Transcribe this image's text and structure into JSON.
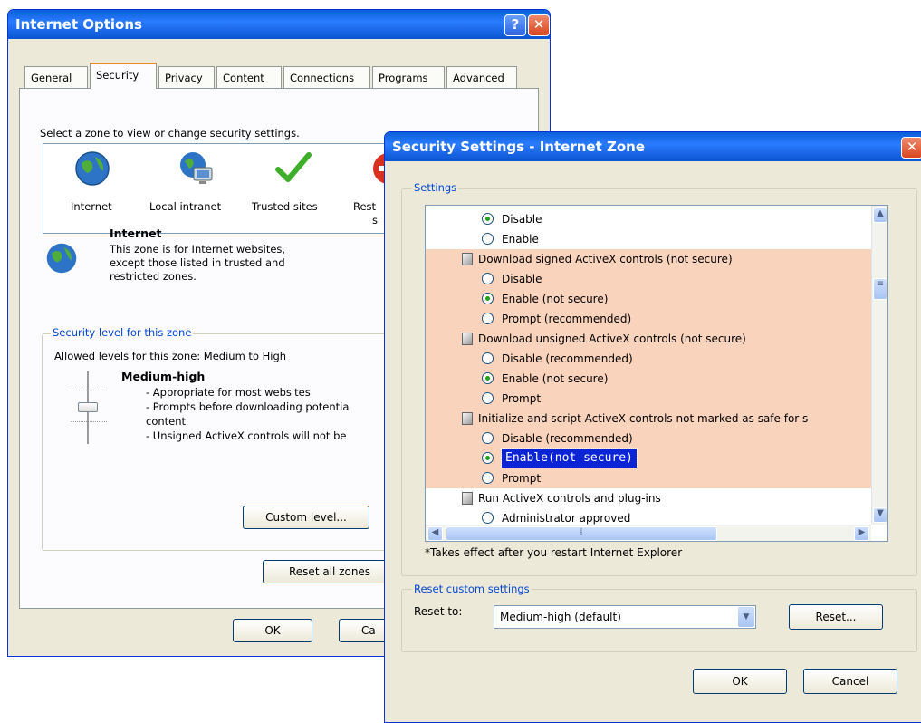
{
  "internet_options": {
    "title": "Internet Options",
    "tabs": [
      "General",
      "Security",
      "Privacy",
      "Content",
      "Connections",
      "Programs",
      "Advanced"
    ],
    "zone_prompt": "Select a zone to view or change security settings.",
    "zones": [
      {
        "label": "Internet",
        "icon": "globe-icon"
      },
      {
        "label": "Local intranet",
        "icon": "intranet-icon"
      },
      {
        "label": "Trusted sites",
        "icon": "checkmark-icon"
      },
      {
        "label": "Rest",
        "label2": "s",
        "icon": "restricted-icon"
      }
    ],
    "zone_title": "Internet",
    "zone_desc_1": "This zone is for Internet websites,",
    "zone_desc_2": "except those listed in trusted and",
    "zone_desc_3": "restricted zones.",
    "security_group": "Security level for this zone",
    "allowed_levels": "Allowed levels for this zone: Medium to High",
    "level_name": "Medium-high",
    "level_bullets": [
      "- Appropriate for most websites",
      "- Prompts before downloading potentia",
      "content",
      "- Unsigned ActiveX controls will not be"
    ],
    "custom_level_button": "Custom level...",
    "reset_all_button": "Reset all zones",
    "ok_button": "OK",
    "cancel_button": "Ca"
  },
  "security_settings": {
    "title": "Security Settings - Internet Zone",
    "settings_group": "Settings",
    "items": [
      {
        "type": "radio",
        "label": "Disable",
        "checked": true
      },
      {
        "type": "radio",
        "label": "Enable",
        "checked": false
      },
      {
        "type": "header",
        "label": "Download signed ActiveX controls (not secure)"
      },
      {
        "type": "radio",
        "label": "Disable",
        "checked": false
      },
      {
        "type": "radio",
        "label": "Enable (not secure)",
        "checked": true
      },
      {
        "type": "radio",
        "label": "Prompt (recommended)",
        "checked": false
      },
      {
        "type": "header",
        "label": "Download unsigned ActiveX controls (not secure)"
      },
      {
        "type": "radio",
        "label": "Disable (recommended)",
        "checked": false
      },
      {
        "type": "radio",
        "label": "Enable (not secure)",
        "checked": true
      },
      {
        "type": "radio",
        "label": "Prompt",
        "checked": false
      },
      {
        "type": "header",
        "label": "Initialize and script ActiveX controls not marked as safe for s"
      },
      {
        "type": "radio",
        "label": "Disable (recommended)",
        "checked": false
      },
      {
        "type": "radio",
        "label": "Enable(not secure)",
        "checked": true,
        "selected": true
      },
      {
        "type": "radio",
        "label": "Prompt",
        "checked": false
      },
      {
        "type": "header",
        "label": "Run ActiveX controls and plug-ins"
      },
      {
        "type": "radio",
        "label": "Administrator approved",
        "checked": false
      }
    ],
    "note": "*Takes effect after you restart Internet Explorer",
    "reset_group": "Reset custom settings",
    "reset_to_label": "Reset to:",
    "reset_to_value": "Medium-high (default)",
    "reset_button": "Reset...",
    "ok_button": "OK",
    "cancel_button": "Cancel"
  },
  "colors": {
    "highlight_rows": "#fad3bd",
    "selection": "#0a24d6",
    "title_blue": "#0a5fd8"
  }
}
